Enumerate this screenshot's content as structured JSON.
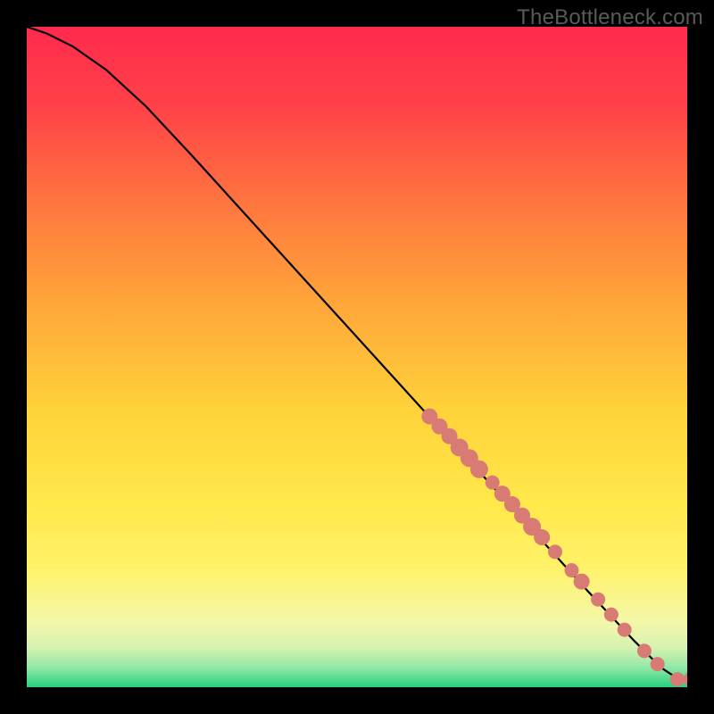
{
  "watermark": "TheBottleneck.com",
  "chart_data": {
    "type": "line",
    "title": "",
    "xlabel": "",
    "ylabel": "",
    "xlim": [
      0,
      100
    ],
    "ylim": [
      0,
      100
    ],
    "background_gradient": {
      "stops": [
        {
          "offset": 0.0,
          "color": "#ff2a4d"
        },
        {
          "offset": 0.12,
          "color": "#ff4148"
        },
        {
          "offset": 0.28,
          "color": "#ff7a3e"
        },
        {
          "offset": 0.42,
          "color": "#ffa63a"
        },
        {
          "offset": 0.58,
          "color": "#ffd23a"
        },
        {
          "offset": 0.72,
          "color": "#ffe84a"
        },
        {
          "offset": 0.82,
          "color": "#fff26a"
        },
        {
          "offset": 0.9,
          "color": "#f4f7a8"
        },
        {
          "offset": 0.94,
          "color": "#d6f2b0"
        },
        {
          "offset": 0.97,
          "color": "#92e8a8"
        },
        {
          "offset": 1.0,
          "color": "#26d07c"
        }
      ]
    },
    "curve": [
      {
        "x": 0.0,
        "y": 100.0
      },
      {
        "x": 3.0,
        "y": 99.0
      },
      {
        "x": 7.0,
        "y": 97.0
      },
      {
        "x": 12.0,
        "y": 93.5
      },
      {
        "x": 18.0,
        "y": 88.0
      },
      {
        "x": 25.0,
        "y": 80.5
      },
      {
        "x": 35.0,
        "y": 69.5
      },
      {
        "x": 45.0,
        "y": 58.5
      },
      {
        "x": 55.0,
        "y": 47.5
      },
      {
        "x": 65.0,
        "y": 36.5
      },
      {
        "x": 75.0,
        "y": 25.5
      },
      {
        "x": 85.0,
        "y": 14.5
      },
      {
        "x": 92.0,
        "y": 7.0
      },
      {
        "x": 96.0,
        "y": 3.0
      },
      {
        "x": 99.0,
        "y": 1.0
      },
      {
        "x": 100.0,
        "y": 1.0
      }
    ],
    "markers": {
      "color": "#d97b75",
      "radius_range": [
        6,
        11
      ],
      "points": [
        {
          "x": 61.0,
          "y": 41.0,
          "r": 9
        },
        {
          "x": 62.5,
          "y": 39.5,
          "r": 9
        },
        {
          "x": 64.0,
          "y": 38.0,
          "r": 9
        },
        {
          "x": 65.5,
          "y": 36.3,
          "r": 10
        },
        {
          "x": 67.0,
          "y": 34.7,
          "r": 10
        },
        {
          "x": 68.5,
          "y": 33.0,
          "r": 10
        },
        {
          "x": 70.5,
          "y": 31.0,
          "r": 8
        },
        {
          "x": 72.0,
          "y": 29.3,
          "r": 9
        },
        {
          "x": 73.5,
          "y": 27.7,
          "r": 9
        },
        {
          "x": 75.0,
          "y": 26.0,
          "r": 9
        },
        {
          "x": 76.5,
          "y": 24.3,
          "r": 10
        },
        {
          "x": 78.0,
          "y": 22.7,
          "r": 9
        },
        {
          "x": 80.0,
          "y": 20.5,
          "r": 8
        },
        {
          "x": 82.5,
          "y": 17.7,
          "r": 8
        },
        {
          "x": 84.0,
          "y": 16.0,
          "r": 9
        },
        {
          "x": 86.5,
          "y": 13.3,
          "r": 8
        },
        {
          "x": 88.5,
          "y": 11.0,
          "r": 8
        },
        {
          "x": 90.5,
          "y": 8.7,
          "r": 8
        },
        {
          "x": 93.5,
          "y": 5.5,
          "r": 8
        },
        {
          "x": 95.5,
          "y": 3.5,
          "r": 8
        },
        {
          "x": 98.5,
          "y": 1.2,
          "r": 8
        },
        {
          "x": 100.5,
          "y": 1.2,
          "r": 8
        }
      ]
    }
  }
}
